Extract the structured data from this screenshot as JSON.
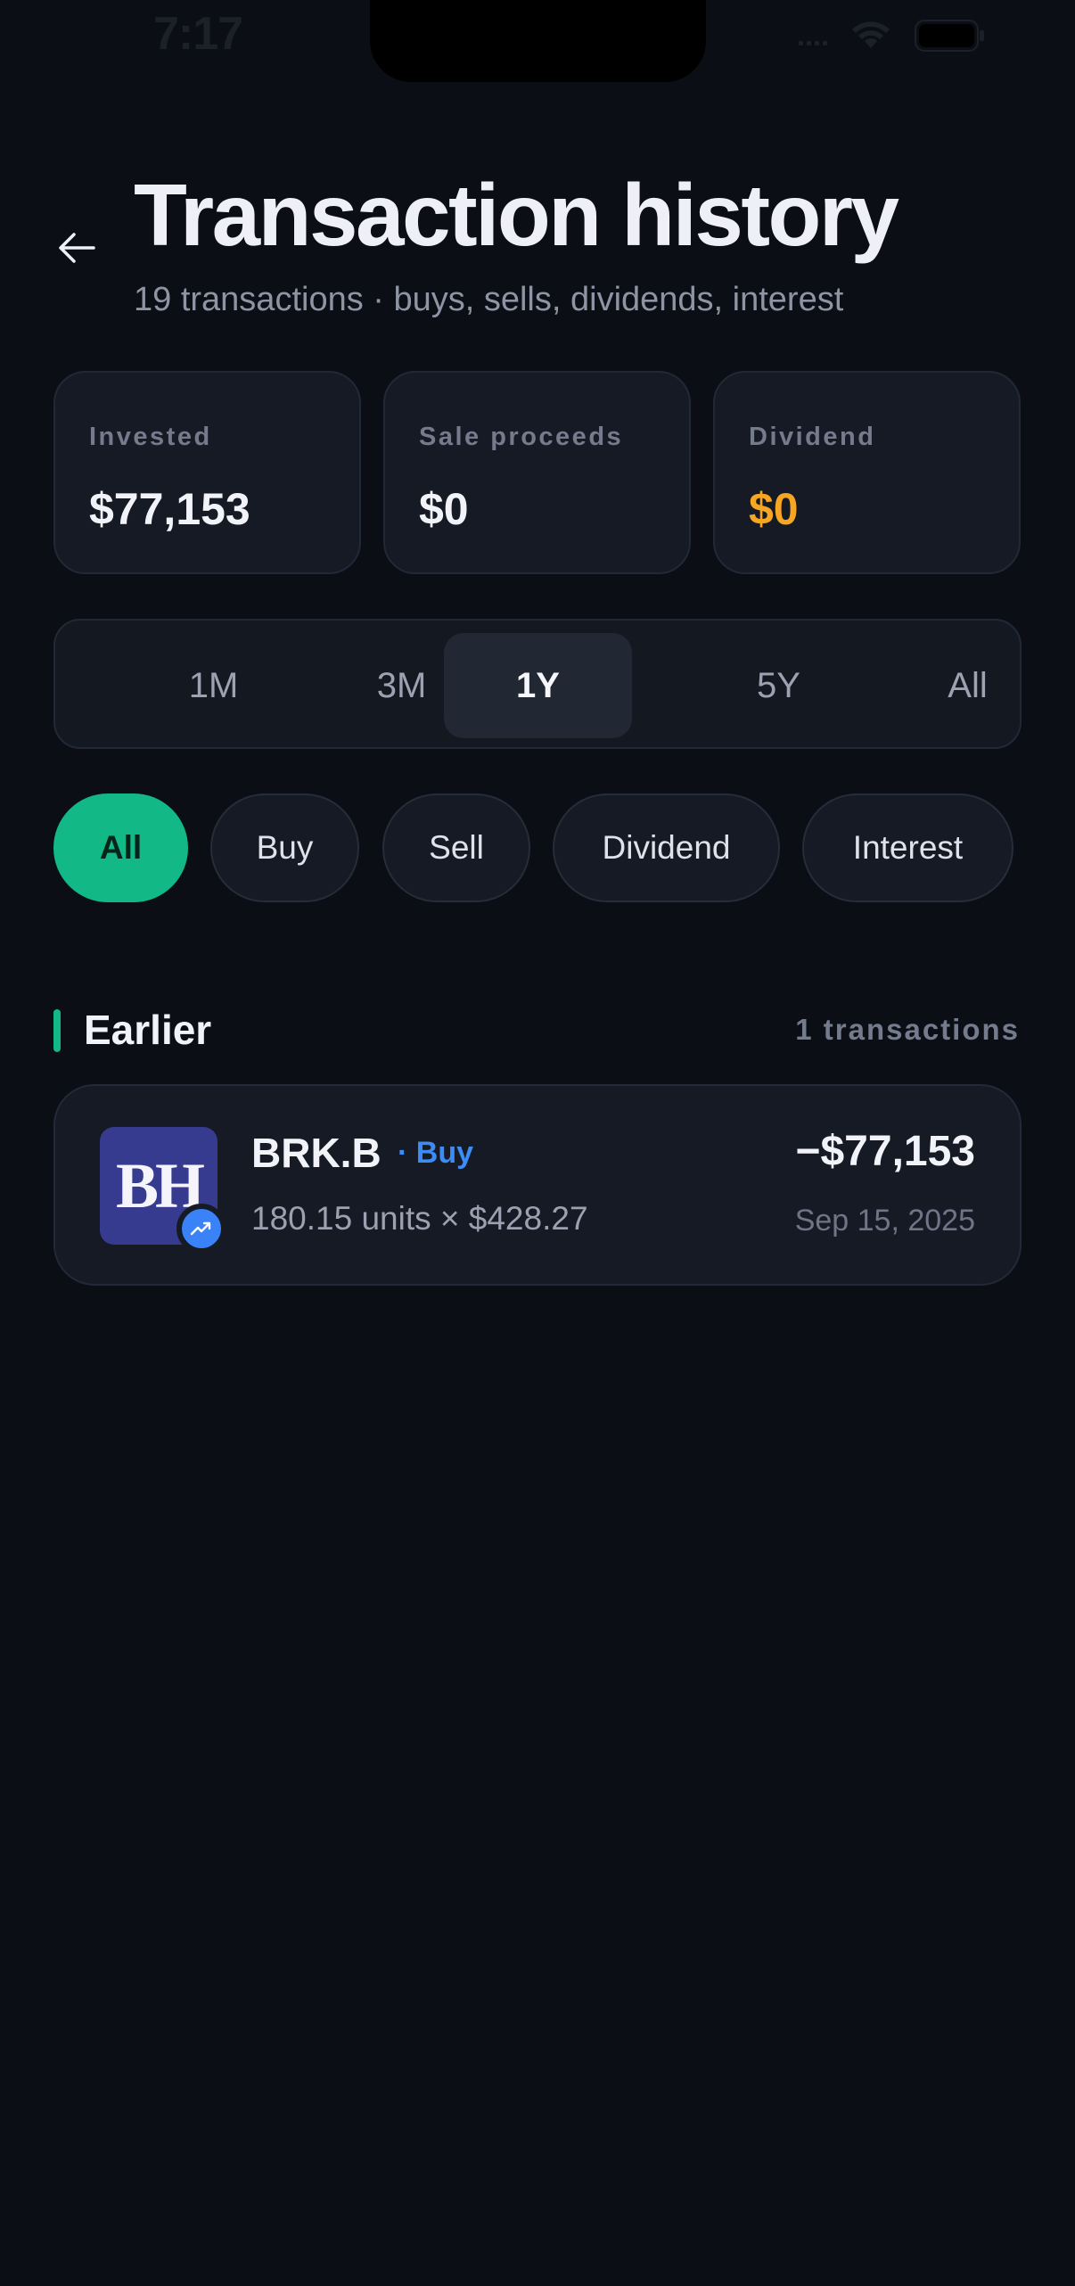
{
  "status_bar": {
    "time": "7:17"
  },
  "header": {
    "title": "Transaction history",
    "subtitle": "19 transactions · buys, sells, dividends, interest"
  },
  "summary": [
    {
      "label": "Invested",
      "value": "$77,153",
      "color": "#f1f3f8"
    },
    {
      "label": "Sale proceeds",
      "value": "$0",
      "color": "#f1f3f8"
    },
    {
      "label": "Dividend",
      "value": "$0",
      "color": "#f5a623"
    }
  ],
  "periods": {
    "items": [
      "1M",
      "3M",
      "1Y",
      "5Y",
      "All"
    ],
    "selected": "1Y"
  },
  "filters": {
    "items": [
      "All",
      "Buy",
      "Sell",
      "Dividend",
      "Interest"
    ],
    "selected": "All",
    "accent": "#12b886"
  },
  "section": {
    "title": "Earlier",
    "count": "1 transactions"
  },
  "transactions": [
    {
      "logo_text": "BH",
      "logo_color": "#363b8f",
      "badge_icon": "trending-up-icon",
      "symbol": "BRK.B",
      "type": "· Buy",
      "type_color": "#3d8cf5",
      "detail": "180.15 units × $428.27",
      "amount": "−$77,153",
      "date": "Sep 15, 2025"
    }
  ]
}
